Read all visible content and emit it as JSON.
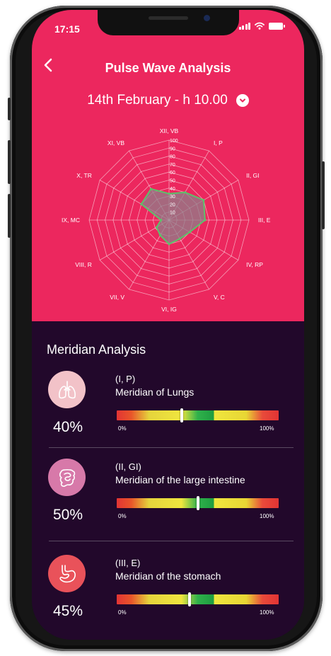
{
  "status_bar": {
    "time": "17:15"
  },
  "header": {
    "title": "Pulse Wave Analysis",
    "date": "14th February - h 10.00"
  },
  "radar": {
    "axes": [
      "XII, VB",
      "I, P",
      "II, GI",
      "III, E",
      "IV, RP",
      "V,  C",
      "VI, IG",
      "VII, V",
      "VIII, R",
      "IX, MC",
      "X, TR",
      "XI, VB"
    ],
    "scale_labels": [
      "10",
      "20",
      "30",
      "40",
      "50",
      "60",
      "70",
      "80",
      "90",
      "100"
    ],
    "values_pct": [
      33,
      40,
      50,
      45,
      30,
      27,
      30,
      22,
      18,
      10,
      40,
      45
    ],
    "colors": {
      "area": "#8f7f8a",
      "outline": "#5dc26a",
      "grid": "#ffffff"
    }
  },
  "meridian_analysis": {
    "title": "Meridian Analysis",
    "scale_min": "0%",
    "scale_max": "100%",
    "items": [
      {
        "code": "(I, P)",
        "name": "Meridian of Lungs",
        "percent": "40%",
        "value": 40,
        "icon": "lungs-icon",
        "icon_bg": "#f2c2c8"
      },
      {
        "code": "(II, GI)",
        "name": "Meridian of the large intestine",
        "percent": "50%",
        "value": 50,
        "icon": "intestine-icon",
        "icon_bg": "#d779a9"
      },
      {
        "code": "(III, E)",
        "name": "Meridian of the stomach",
        "percent": "45%",
        "value": 45,
        "icon": "stomach-icon",
        "icon_bg": "#e9525a"
      }
    ]
  }
}
